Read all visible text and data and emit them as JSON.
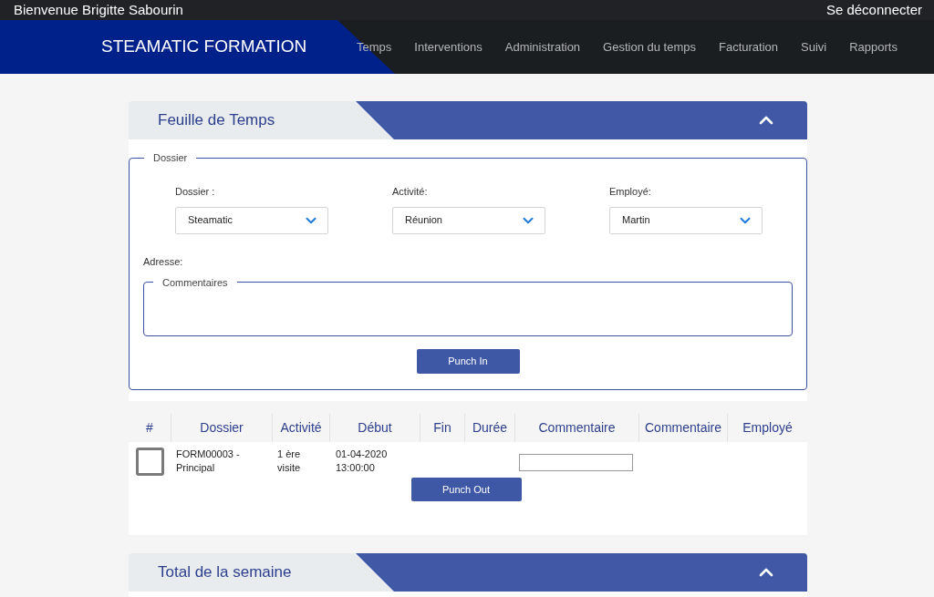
{
  "top_bar": {
    "greeting": "Bienvenue Brigitte Sabourin",
    "logout": "Se déconnecter"
  },
  "nav": {
    "brand": "STEAMATIC FORMATION",
    "items": [
      "Temps",
      "Interventions",
      "Administration",
      "Gestion du temps",
      "Facturation",
      "Suivi",
      "Rapports"
    ]
  },
  "timesheet": {
    "title": "Feuille de Temps",
    "expanded": true,
    "form": {
      "legend": "Dossier",
      "fields": [
        {
          "label": "Dossier :",
          "value": "Steamatic"
        },
        {
          "label": "Activité:",
          "value": "Réunion"
        },
        {
          "label": "Employé:",
          "value": "Martin"
        }
      ],
      "address_label": "Adresse:",
      "comments_legend": "Commentaires",
      "button": "Punch In"
    },
    "table": {
      "columns": [
        "#",
        "Dossier",
        "Activité",
        "Début",
        "Fin",
        "Durée",
        "Commentaire",
        "Commentaire",
        "Employé"
      ],
      "rows": [
        {
          "checked": false,
          "dossier": "FORM00003 - Principal",
          "activite": "1 ère visite",
          "debut": "01-04-2020 13:00:00"
        }
      ],
      "button": "Punch Out"
    }
  },
  "weekly_total": {
    "title": "Total de la semaine",
    "expanded": true
  }
}
